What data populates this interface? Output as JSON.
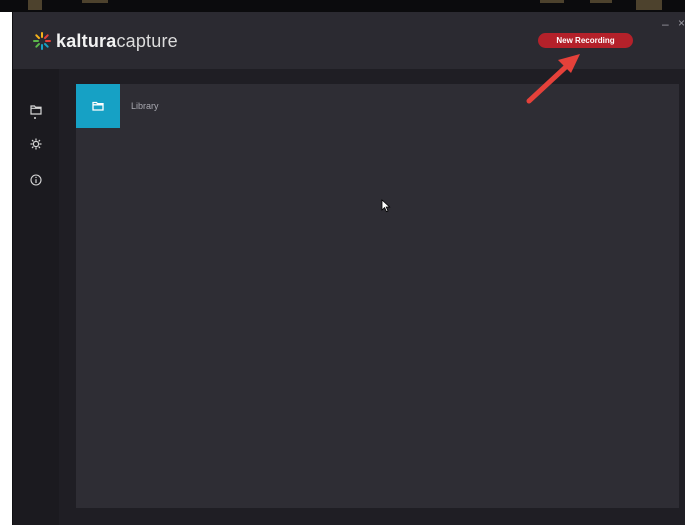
{
  "app": {
    "logo": {
      "brand_bold": "kaltura",
      "brand_light": "capture"
    },
    "colors": {
      "accent": "#16a1c5",
      "record": "#b4212a",
      "annotation_arrow": "#e5413a"
    }
  },
  "header": {
    "new_recording_label": "New Recording",
    "window_controls": {
      "minimize": "–",
      "close": "×"
    }
  },
  "sidebar": {
    "items": [
      {
        "icon": "folder-icon",
        "active": true
      },
      {
        "icon": "gear-icon",
        "active": false
      },
      {
        "icon": "info-icon",
        "active": false
      }
    ]
  },
  "main": {
    "section_icon": "folder-icon",
    "section_label": "Library"
  }
}
